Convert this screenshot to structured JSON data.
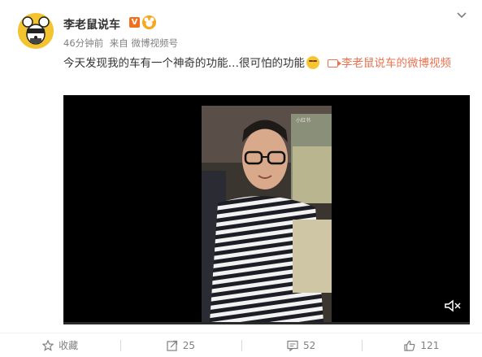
{
  "post": {
    "username": "李老鼠说车",
    "verified_badge": "V",
    "time": "46分钟前",
    "source": "来自 微博视频号",
    "text": "今天发现我的车有一个神奇的功能…很可怕的功能",
    "video_link_label": "李老鼠说车的微博视频"
  },
  "video": {
    "watermark": "小红书"
  },
  "actions": {
    "favorite_label": "收藏",
    "repost_count": "25",
    "comment_count": "52",
    "like_count": "121"
  },
  "colors": {
    "link": "#eb7350",
    "verified": "#f26f1e",
    "meta": "#808080"
  }
}
